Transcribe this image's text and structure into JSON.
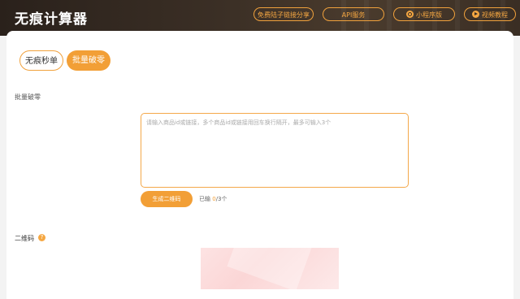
{
  "header": {
    "title": "无痕计算器",
    "nav": [
      {
        "label": "免费陆子链接分享"
      },
      {
        "label": "API服务"
      },
      {
        "label": "小程序版"
      },
      {
        "label": "视频教程"
      }
    ]
  },
  "tabs": [
    {
      "label": "无痕秒单",
      "active": false
    },
    {
      "label": "批量破零",
      "active": true
    }
  ],
  "form": {
    "section_label": "批量破零",
    "placeholder": "请输入商品id或链接，多个商品id或链接用回车换行隔开，最多可输入3个",
    "value": "",
    "generate_button": "生成二维码",
    "count_prefix": "已输",
    "count_current": "0",
    "count_suffix": "/3个"
  },
  "qr": {
    "label": "二维码",
    "help_glyph": "?"
  },
  "colors": {
    "accent": "#f29f36",
    "header_bg": "#3c3026"
  }
}
